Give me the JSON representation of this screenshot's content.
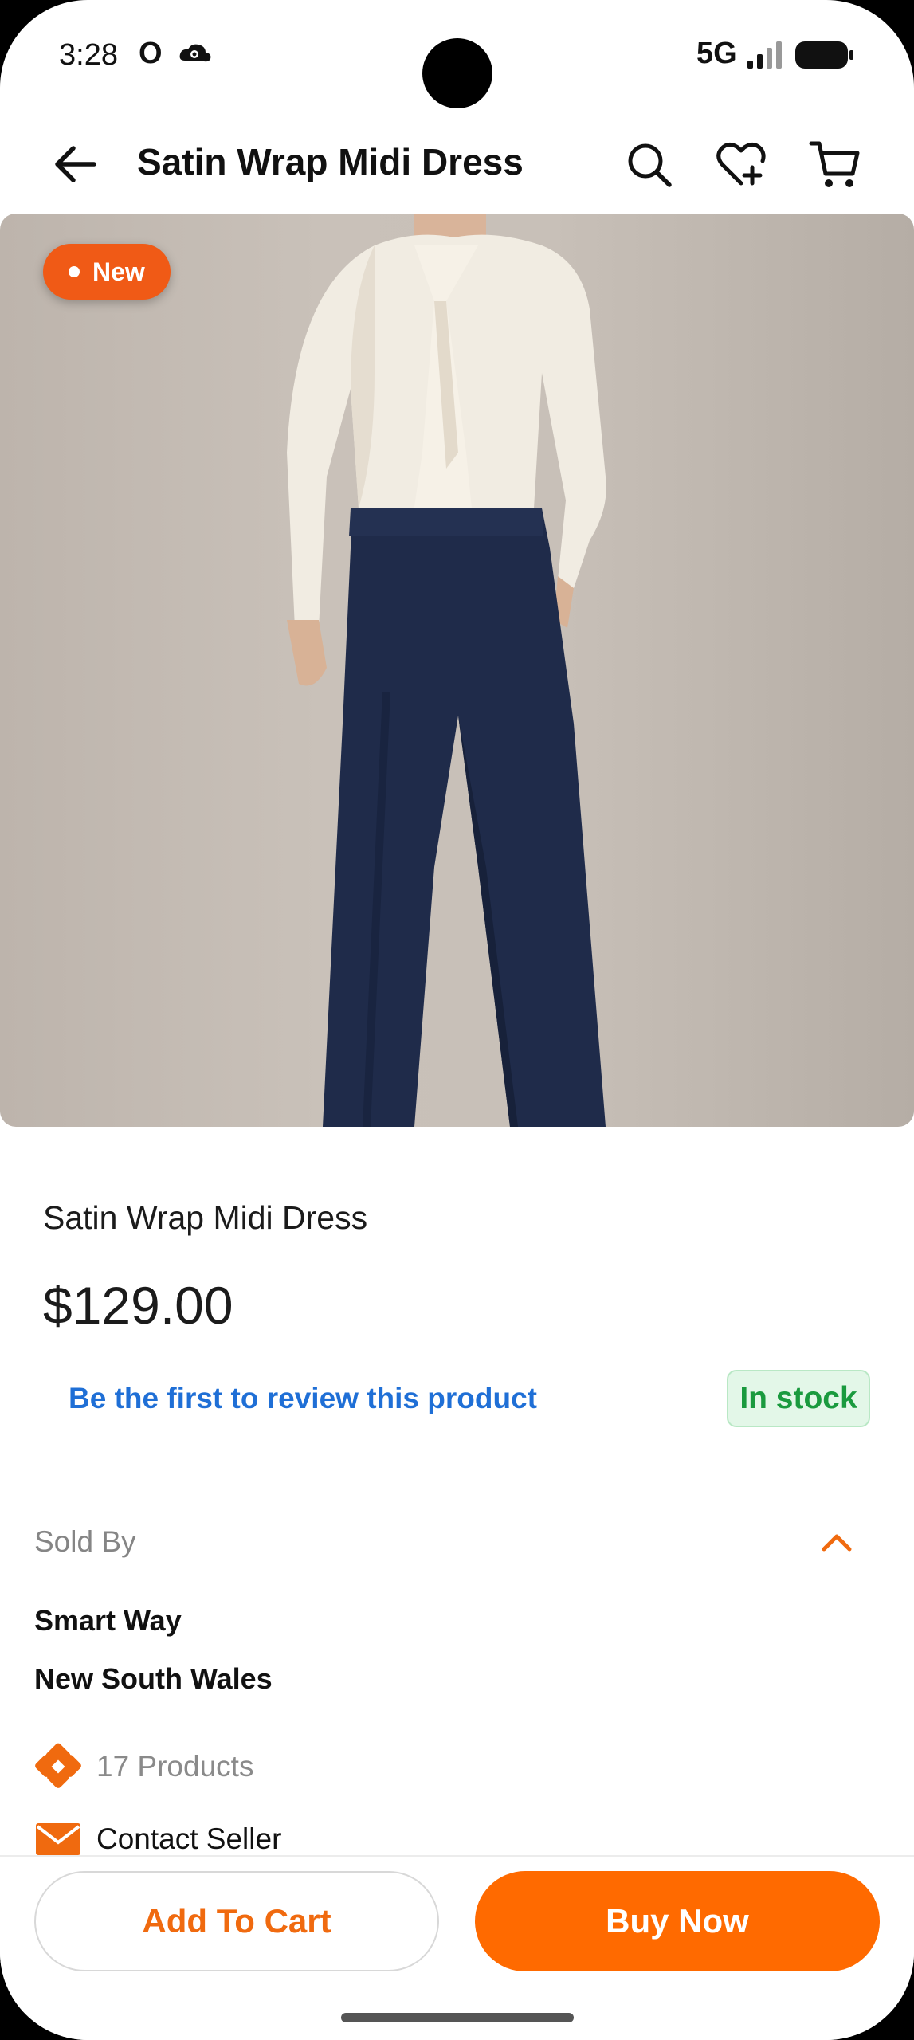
{
  "status_bar": {
    "time": "3:28",
    "app_letter": "O",
    "network": "5G",
    "icons": [
      "o-app-icon",
      "cloud-sync-icon",
      "signal-bars-icon",
      "battery-icon"
    ]
  },
  "header": {
    "title": "Satin Wrap Midi Dress",
    "icons": [
      "back-arrow-icon",
      "search-icon",
      "wishlist-heart-plus-icon",
      "cart-icon"
    ]
  },
  "gallery": {
    "badge": "New",
    "image_subject": "model-photo"
  },
  "product": {
    "name": "Satin Wrap Midi Dress",
    "price": "$129.00",
    "review_link": "Be the first to review this product",
    "stock": "In stock"
  },
  "seller": {
    "section_label": "Sold By",
    "name": "Smart Way",
    "region": "New South Wales",
    "products_count": "17 Products",
    "contact_label": "Contact Seller"
  },
  "actions": {
    "add_to_cart": "Add To Cart",
    "buy_now": "Buy Now"
  },
  "colors": {
    "accent": "#ff6a00",
    "link": "#1f6fd6",
    "stock_green": "#1a9a3e",
    "stock_bg": "#e3f7e8"
  }
}
